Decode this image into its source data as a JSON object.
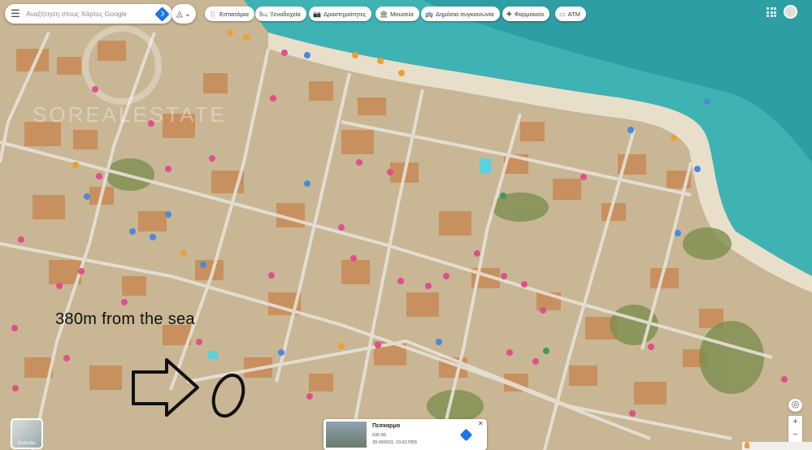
{
  "search": {
    "placeholder": "Αναζήτηση στους Χάρτες Google",
    "menu_icon": "hamburger-menu-icon",
    "directions_icon": "directions-icon"
  },
  "layers_button": {
    "icon": "layers-icon"
  },
  "category_chips": [
    {
      "label": "Εστιατόρια",
      "icon": "restaurant-icon"
    },
    {
      "label": "Ξενοδοχεία",
      "icon": "hotel-icon"
    },
    {
      "label": "Δραστηριότητες",
      "icon": "camera-icon"
    },
    {
      "label": "Μουσεία",
      "icon": "museum-icon"
    },
    {
      "label": "Δημόσια συγκοινωνία",
      "icon": "bus-icon"
    },
    {
      "label": "Φαρμακεία",
      "icon": "pharmacy-icon"
    },
    {
      "label": "ATM",
      "icon": "atm-icon"
    }
  ],
  "annotation": {
    "text": "380m from the sea"
  },
  "layers_thumbnail": {
    "label": "Επίπεδα"
  },
  "place_card": {
    "title": "Πεσκαρμα",
    "line1": "636 85",
    "line2": "39.965631, 23.617955"
  },
  "map_controls": {
    "zoom_in": "+",
    "zoom_out": "−"
  },
  "colors": {
    "sea": "#3fb2b3",
    "beach": "#e8dfcb",
    "streets": "#e7e2d8",
    "roofs": "#c98a55",
    "marker_pink": "#e14f8a",
    "marker_orange": "#e8a13a",
    "marker_blue": "#4a8ad8",
    "water_deep": "#2d9ea4"
  }
}
